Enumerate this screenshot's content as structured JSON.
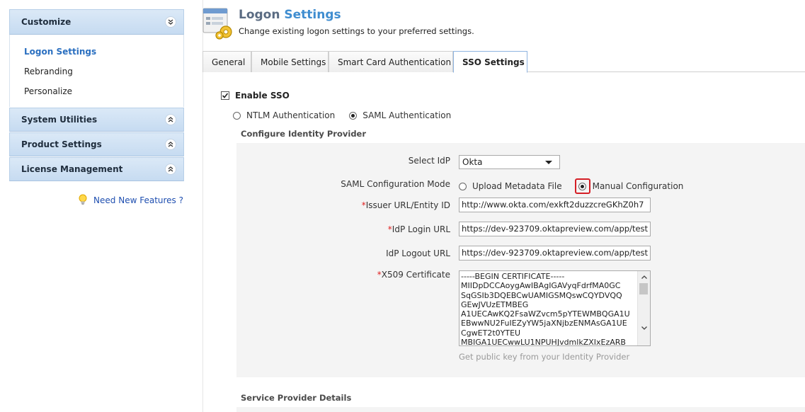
{
  "sidebar": {
    "customize": {
      "label": "Customize",
      "items": [
        "Logon Settings",
        "Rebranding",
        "Personalize"
      ]
    },
    "system_utilities": "System Utilities",
    "product_settings": "Product Settings",
    "license_management": "License Management",
    "features_link": "Need New Features ?"
  },
  "header": {
    "title_part1": "Logon",
    "title_part2": "Settings",
    "subtitle": "Change existing logon settings to your preferred settings."
  },
  "tabs": [
    {
      "label": "General"
    },
    {
      "label": "Mobile Settings"
    },
    {
      "label": "Smart Card Authentication"
    },
    {
      "label": "SSO Settings"
    }
  ],
  "sso": {
    "enable_label": "Enable SSO",
    "enabled": true,
    "ntlm_label": "NTLM Authentication",
    "saml_label": "SAML Authentication",
    "selected_auth": "SAML Authentication",
    "idp_section_title": "Configure Identity Provider",
    "select_idp_label": "Select IdP",
    "idp_value": "Okta",
    "mode_label": "SAML Configuration Mode",
    "upload_label": "Upload Metadata File",
    "manual_label": "Manual Configuration",
    "selected_mode": "Manual Configuration",
    "issuer_label": "Issuer URL/Entity ID",
    "issuer_value": "http://www.okta.com/exkft2duzzcreGKhZ0h7",
    "login_url_label": "IdP Login URL",
    "login_url_value": "https://dev-923709.oktapreview.com/app/test",
    "logout_url_label": "IdP Logout URL",
    "logout_url_value": "https://dev-923709.oktapreview.com/app/test",
    "cert_label": "X509 Certificate",
    "cert_value": "-----BEGIN CERTIFICATE-----\nMIIDpDCCAoygAwIBAgIGAVyqFdrfMA0GC\nSqGSIb3DQEBCwUAMIGSMQswCQYDVQQ\nGEwJVUzETMBEG\nA1UECAwKQ2FsaWZvcm5pYTEWMBQGA1U\nEBwwNU2FuIEZyYW5jaXNjbzENMAsGA1UE\nCgwET2t0YTEU\nMBIGA1UECwwLU1NPUHJvdmlkZXIxEzARB",
    "cert_hint": "Get public key from your Identity Provider",
    "sp_section_title": "Service Provider Details"
  }
}
